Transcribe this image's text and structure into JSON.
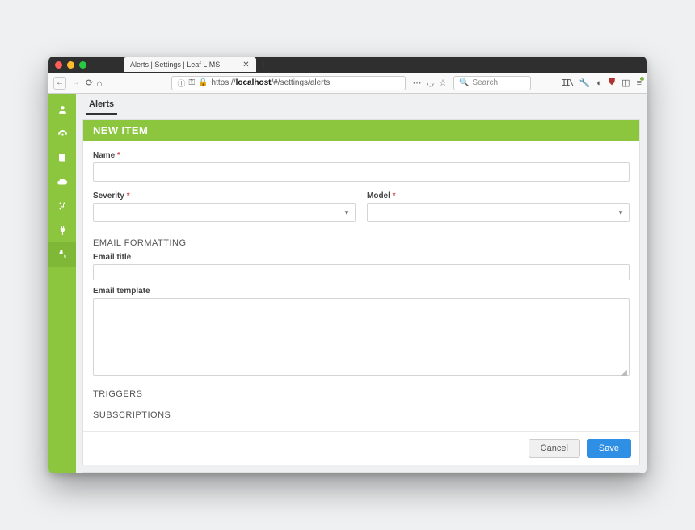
{
  "tab_title": "Alerts | Settings | Leaf LIMS",
  "url_host": "localhost",
  "url_rest": "/#/settings/alerts",
  "search_placeholder": "Search",
  "content_tab": "Alerts",
  "card_title": "NEW ITEM",
  "fields": {
    "name_label": "Name",
    "severity_label": "Severity",
    "model_label": "Model",
    "email_formatting": "EMAIL FORMATTING",
    "email_title_label": "Email title",
    "email_template_label": "Email template",
    "triggers": "TRIGGERS",
    "subscriptions": "SUBSCRIPTIONS"
  },
  "values": {
    "name": "",
    "severity": "",
    "model": "",
    "email_title": "",
    "email_template": ""
  },
  "buttons": {
    "cancel": "Cancel",
    "save": "Save"
  },
  "required_marker": "*",
  "url_prefix": "https://"
}
